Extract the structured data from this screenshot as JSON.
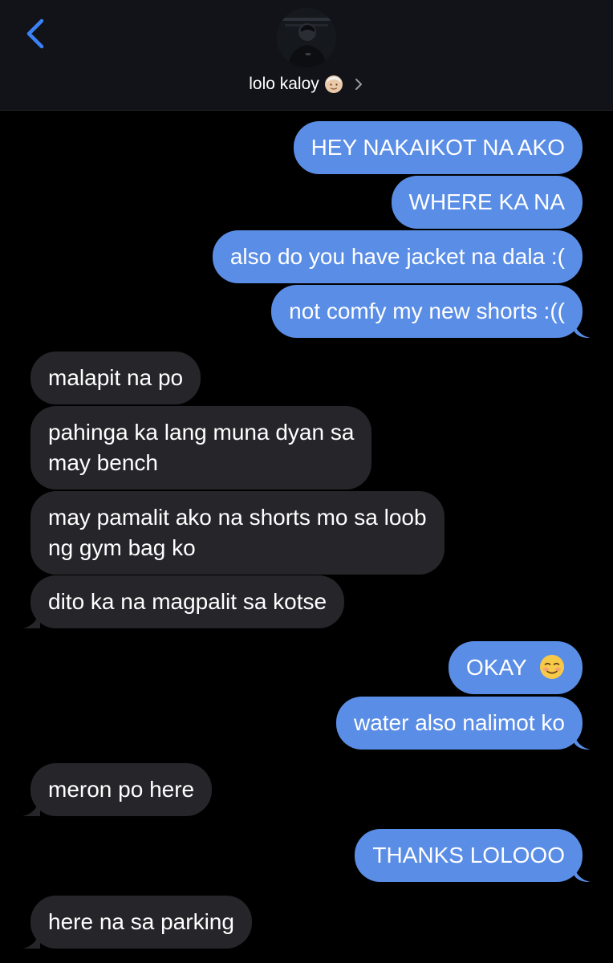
{
  "header": {
    "back_icon": "chevron-left-icon",
    "contact_name": "lolo kaloy",
    "contact_emoji": "older-man-emoji",
    "detail_icon": "chevron-right-icon",
    "accent_color": "#3b82f6"
  },
  "messages": [
    {
      "direction": "out",
      "text": "HEY NAKAIKOT NA AKO"
    },
    {
      "direction": "out",
      "text": "WHERE KA NA"
    },
    {
      "direction": "out",
      "text": "also do you have jacket na dala :("
    },
    {
      "direction": "out",
      "text": "not comfy my new shorts :(("
    },
    {
      "direction": "in",
      "text": "malapit na po"
    },
    {
      "direction": "in",
      "line1": "pahinga ka lang muna dyan sa",
      "line2": "may bench"
    },
    {
      "direction": "in",
      "line1": "may pamalit ako na shorts mo sa loob",
      "line2": "ng gym bag ko"
    },
    {
      "direction": "in",
      "text": "dito ka na magpalit sa kotse"
    },
    {
      "direction": "out",
      "text": "OKAY",
      "emoji": "smiling-blush-emoji"
    },
    {
      "direction": "out",
      "text": "water also nalimot ko"
    },
    {
      "direction": "in",
      "text": "meron po here"
    },
    {
      "direction": "out",
      "text": "THANKS LOLOOO"
    },
    {
      "direction": "in",
      "text": "here na sa parking"
    }
  ],
  "colors": {
    "outgoing_bubble": "#5a8de6",
    "incoming_bubble": "#26262a",
    "background": "#000000",
    "header_bg": "#111318"
  }
}
